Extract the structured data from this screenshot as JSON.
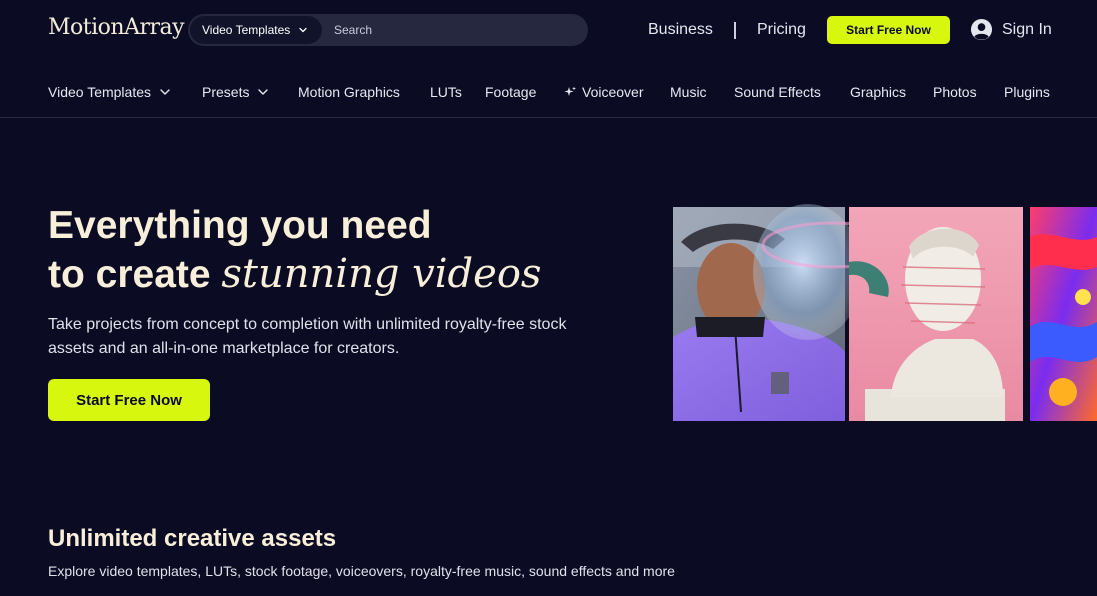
{
  "header": {
    "logo_part1": "Motion",
    "logo_part2": "Array",
    "search": {
      "category": "Video Templates",
      "placeholder": "Search"
    },
    "links": {
      "business": "Business",
      "divider": "|",
      "pricing": "Pricing",
      "cta": "Start Free Now",
      "sign_in": "Sign In"
    }
  },
  "nav": {
    "video_templates": "Video Templates",
    "presets": "Presets",
    "motion_graphics": "Motion Graphics",
    "luts": "LUTs",
    "footage": "Footage",
    "voiceover": "Voiceover",
    "music": "Music",
    "sound_effects": "Sound Effects",
    "graphics": "Graphics",
    "photos": "Photos",
    "plugins": "Plugins"
  },
  "hero": {
    "title_line1": "Everything you need",
    "title_line2_plain": "to create ",
    "title_line2_italic": "stunning videos",
    "subtitle": "Take projects from concept to completion with unlimited royalty-free stock assets and an all-in-one marketplace for creators.",
    "cta": "Start Free Now"
  },
  "section": {
    "title": "Unlimited creative assets",
    "subtitle": "Explore video templates, LUTs, stock footage, voiceovers, royalty-free music, sound effects and more"
  },
  "icons": {
    "search_chevron": "chevron-down-icon",
    "nav_chevron": "chevron-down-icon",
    "voiceover": "sparkle-icon",
    "user": "user-circle-icon"
  },
  "colors": {
    "background": "#0b0b24",
    "accent": "#d7f70e",
    "headline": "#f7efd9"
  }
}
